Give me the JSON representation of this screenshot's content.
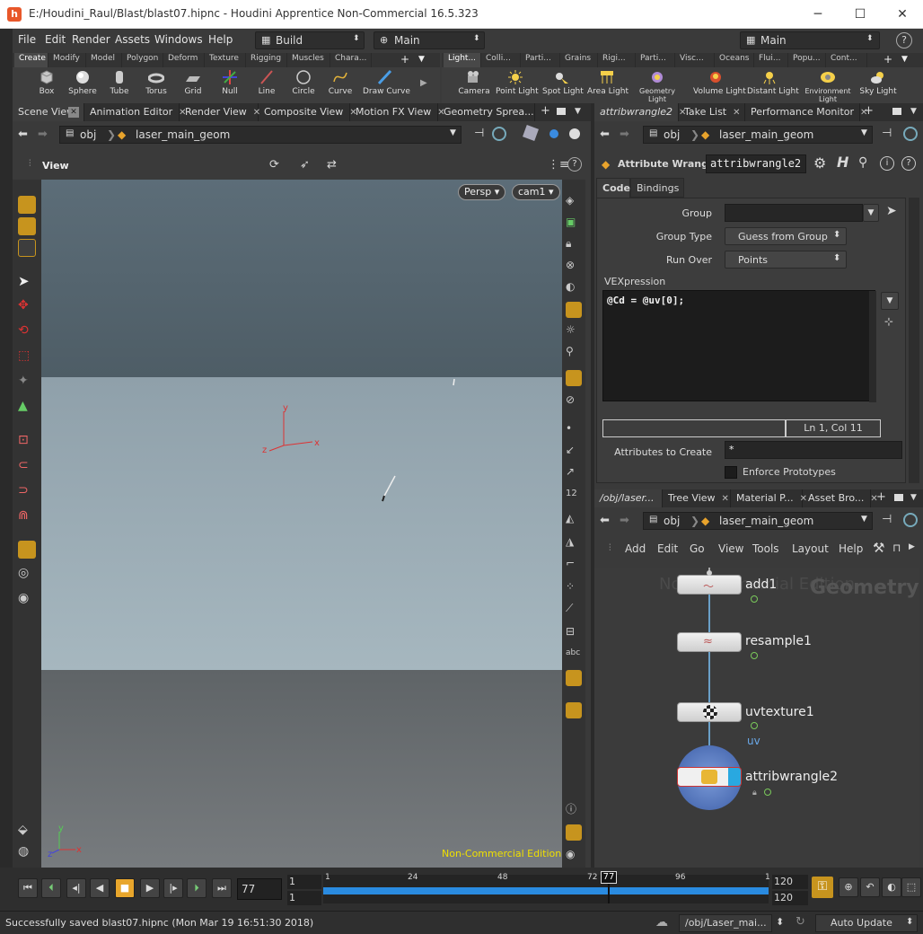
{
  "window": {
    "title": "E:/Houdini_Raul/Blast/blast07.hipnc - Houdini Apprentice Non-Commercial 16.5.323",
    "minimize": "─",
    "maximize": "☐",
    "close": "✕"
  },
  "menu": {
    "items": [
      "File",
      "Edit",
      "Render",
      "Assets",
      "Windows",
      "Help"
    ],
    "desktop": "Build",
    "desktop_context": "Main",
    "desktop_right": "Main",
    "help_icon": "?"
  },
  "shelf_left": {
    "tabs": [
      "Create",
      "Modify",
      "Model",
      "Polygon",
      "Deform",
      "Texture",
      "Rigging",
      "Muscles",
      "Chara..."
    ],
    "tools": [
      "Box",
      "Sphere",
      "Tube",
      "Torus",
      "Grid",
      "Null",
      "Line",
      "Circle",
      "Curve",
      "Draw Curve"
    ]
  },
  "shelf_right": {
    "tabs": [
      "Light...",
      "Colli...",
      "Parti...",
      "Grains",
      "Rigi...",
      "Parti...",
      "Visc...",
      "Oceans",
      "Flui...",
      "Popu...",
      "Cont..."
    ],
    "tools": [
      "Camera",
      "Point Light",
      "Spot Light",
      "Area Light",
      "Geometry Light",
      "Volume Light",
      "Distant Light",
      "Environment Light",
      "Sky Light"
    ]
  },
  "left_pane": {
    "tabs": [
      "Scene View",
      "Animation Editor",
      "Render View",
      "Composite View",
      "Motion FX View",
      "Geometry Sprea..."
    ],
    "path": {
      "root": "obj",
      "node": "laser_main_geom"
    },
    "view_label": "View",
    "persp_button": "Persp",
    "camera_button": "cam1",
    "watermark": "Non-Commercial Edition",
    "axis": {
      "x": "x",
      "y": "y",
      "z": "z"
    }
  },
  "param_pane": {
    "tabs": [
      "attribwrangle2",
      "Take List",
      "Performance Monitor"
    ],
    "path": {
      "root": "obj",
      "node": "laser_main_geom"
    },
    "node_type": "Attribute Wrangle",
    "node_name": "attribwrangle2",
    "subtabs": [
      "Code",
      "Bindings"
    ],
    "group_label": "Group",
    "group_value": "",
    "group_type_label": "Group Type",
    "group_type_value": "Guess from Group",
    "run_over_label": "Run Over",
    "run_over_value": "Points",
    "vex_label": "VEXpression",
    "vex_code": "@Cd = @uv[0];",
    "cursor_pos": "Ln 1, Col 11",
    "attrs_label": "Attributes to Create",
    "attrs_value": "*",
    "enforce_label": "Enforce Prototypes"
  },
  "network_pane": {
    "tabs": [
      "/obj/laser...",
      "Tree View",
      "Material P...",
      "Asset Bro..."
    ],
    "path": {
      "root": "obj",
      "node": "laser_main_geom"
    },
    "menu": [
      "Add",
      "Edit",
      "Go",
      "View",
      "Tools",
      "Layout",
      "Help"
    ],
    "watermark_edition": "Non-Commercial Edition",
    "watermark_context": "Geometry",
    "nodes": [
      {
        "name": "add1"
      },
      {
        "name": "resample1"
      },
      {
        "name": "uvtexture1",
        "attr": "uv"
      },
      {
        "name": "attribwrangle2"
      }
    ]
  },
  "timeline": {
    "current_frame": "77",
    "start": "1",
    "start2": "1",
    "end": "120",
    "end2": "120",
    "ticks": [
      "1",
      "24",
      "48",
      "72",
      "96"
    ],
    "marker": "77",
    "range_end_tick": "1",
    "frame_fraction": 0.639
  },
  "status": {
    "message": "Successfully saved blast07.hipnc (Mon Mar 19 16:51:30 2018)",
    "network_path": "/obj/Laser_mai...",
    "update_mode": "Auto Update"
  },
  "colors": {
    "accent_orange": "#f0b400",
    "timeline_blue": "#2a8be0",
    "flag_green": "#7ac95b",
    "watermark_yellow": "#f0e000"
  }
}
